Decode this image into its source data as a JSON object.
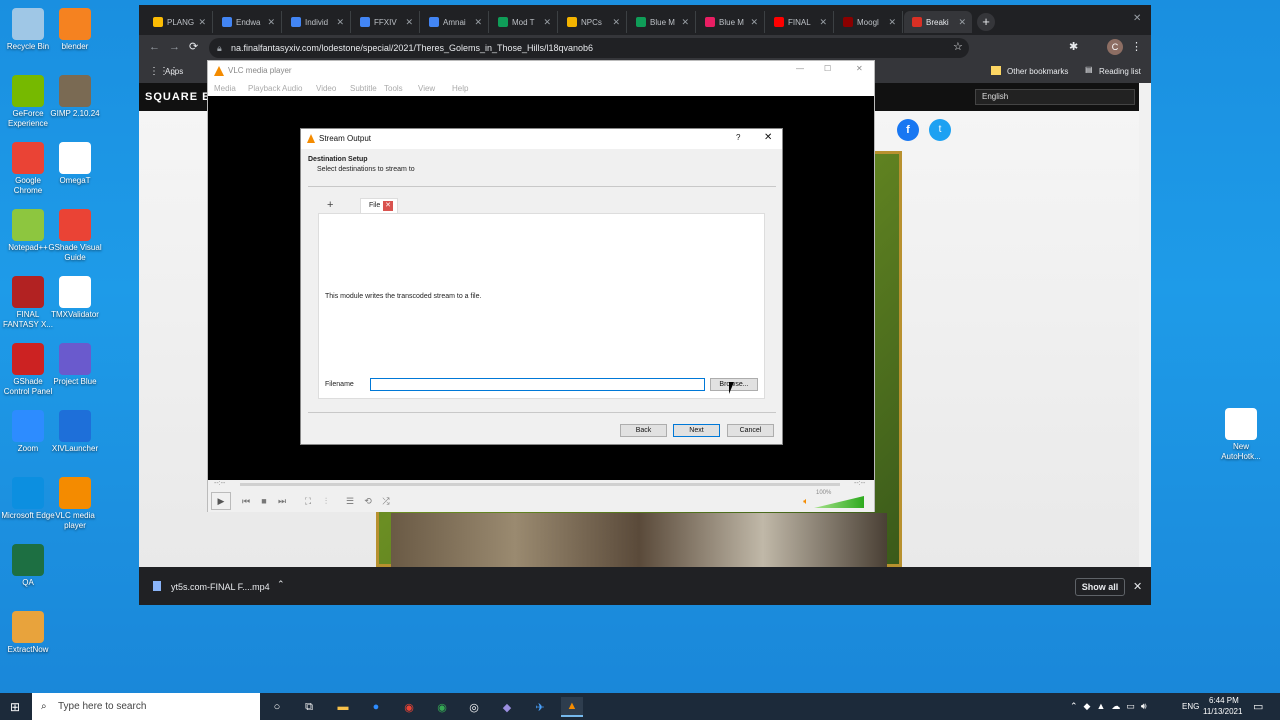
{
  "desktop_icons": [
    {
      "label": "Recycle Bin",
      "icon": "recycle-bin-icon",
      "color": "#9fc7e6"
    },
    {
      "label": "blender",
      "icon": "blender-icon",
      "color": "#f58220"
    },
    {
      "label": "GeForce Experience",
      "icon": "geforce-icon",
      "color": "#76b900"
    },
    {
      "label": "GIMP 2.10.24",
      "icon": "gimp-icon",
      "color": "#7a6a53"
    },
    {
      "label": "Google Chrome",
      "icon": "chrome-icon",
      "color": "#ea4335"
    },
    {
      "label": "OmegaT",
      "icon": "omegat-icon",
      "color": "#ffffff"
    },
    {
      "label": "Notepad++",
      "icon": "notepad-plus-plus-icon",
      "color": "#8dc63f"
    },
    {
      "label": "GShade Visual Guide",
      "icon": "chrome-icon",
      "color": "#ea4335"
    },
    {
      "label": "FINAL FANTASY X...",
      "icon": "ffxiv-icon",
      "color": "#b22222"
    },
    {
      "label": "TMXValidator",
      "icon": "tmx-icon",
      "color": "#ffffff"
    },
    {
      "label": "GShade Control Panel",
      "icon": "gshade-icon",
      "color": "#cc2222"
    },
    {
      "label": "Project Blue",
      "icon": "project-blue-icon",
      "color": "#6a5acd"
    },
    {
      "label": "Zoom",
      "icon": "zoom-icon",
      "color": "#2d8cff"
    },
    {
      "label": "XIVLauncher",
      "icon": "xivlauncher-icon",
      "color": "#1e6fd9"
    },
    {
      "label": "Microsoft Edge",
      "icon": "edge-icon",
      "color": "#0c8fe0"
    },
    {
      "label": "VLC media player",
      "icon": "vlc-icon",
      "color": "#f48b00"
    },
    {
      "label": "QA",
      "icon": "excel-icon",
      "color": "#1d6f42"
    },
    {
      "label": "ExtractNow",
      "icon": "extractnow-icon",
      "color": "#e8a33c"
    },
    {
      "label": "New AutoHotk...",
      "icon": "autohotkey-icon",
      "color": "#ffffff"
    }
  ],
  "browser": {
    "tabs": [
      {
        "title": "PLANG",
        "color": "#fbbc04"
      },
      {
        "title": "Endwa",
        "color": "#4285f4"
      },
      {
        "title": "Individ",
        "color": "#4285f4"
      },
      {
        "title": "FFXIV",
        "color": "#4285f4"
      },
      {
        "title": "Amnai",
        "color": "#4285f4"
      },
      {
        "title": "Mod T",
        "color": "#0f9d58"
      },
      {
        "title": "NPCs",
        "color": "#f4b400"
      },
      {
        "title": "Blue M",
        "color": "#0f9d58"
      },
      {
        "title": "Blue M",
        "color": "#e91e63"
      },
      {
        "title": "FINAL",
        "color": "#ff0000"
      },
      {
        "title": "Moogl",
        "color": "#8b0000"
      },
      {
        "title": "Breaki",
        "color": "#d93025"
      }
    ],
    "url": "na.finalfantasyxiv.com/lodestone/special/2021/Theres_Golems_in_Those_Hills/l18qvanob6",
    "bookmarks": {
      "apps": "Apps",
      "other": "Other bookmarks",
      "reading": "Reading list"
    },
    "site_logo": "SQUARE E",
    "language": "English",
    "download_file": "yt5s.com-FINAL F....mp4",
    "show_all": "Show all"
  },
  "vlc": {
    "title": "VLC media player",
    "menu": [
      "Media",
      "Playback",
      "Audio",
      "Video",
      "Subtitle",
      "Tools",
      "View",
      "Help"
    ],
    "time_left": "--:--",
    "time_right": "--:--",
    "volume": "100%",
    "volume_level": 1.0
  },
  "dialog": {
    "title": "Stream Output",
    "help": "?",
    "section_title": "Destination Setup",
    "section_sub": "Select destinations to stream to",
    "add_tab": "+",
    "file_tab": "File",
    "module_text": "This module writes the transcoded stream to a file.",
    "filename_label": "Filename",
    "filename_value": "",
    "browse": "Browse...",
    "back": "Back",
    "next": "Next",
    "cancel": "Cancel"
  },
  "taskbar": {
    "search_placeholder": "Type here to search",
    "lang": "ENG",
    "time": "6:44 PM",
    "date": "11/13/2021"
  }
}
